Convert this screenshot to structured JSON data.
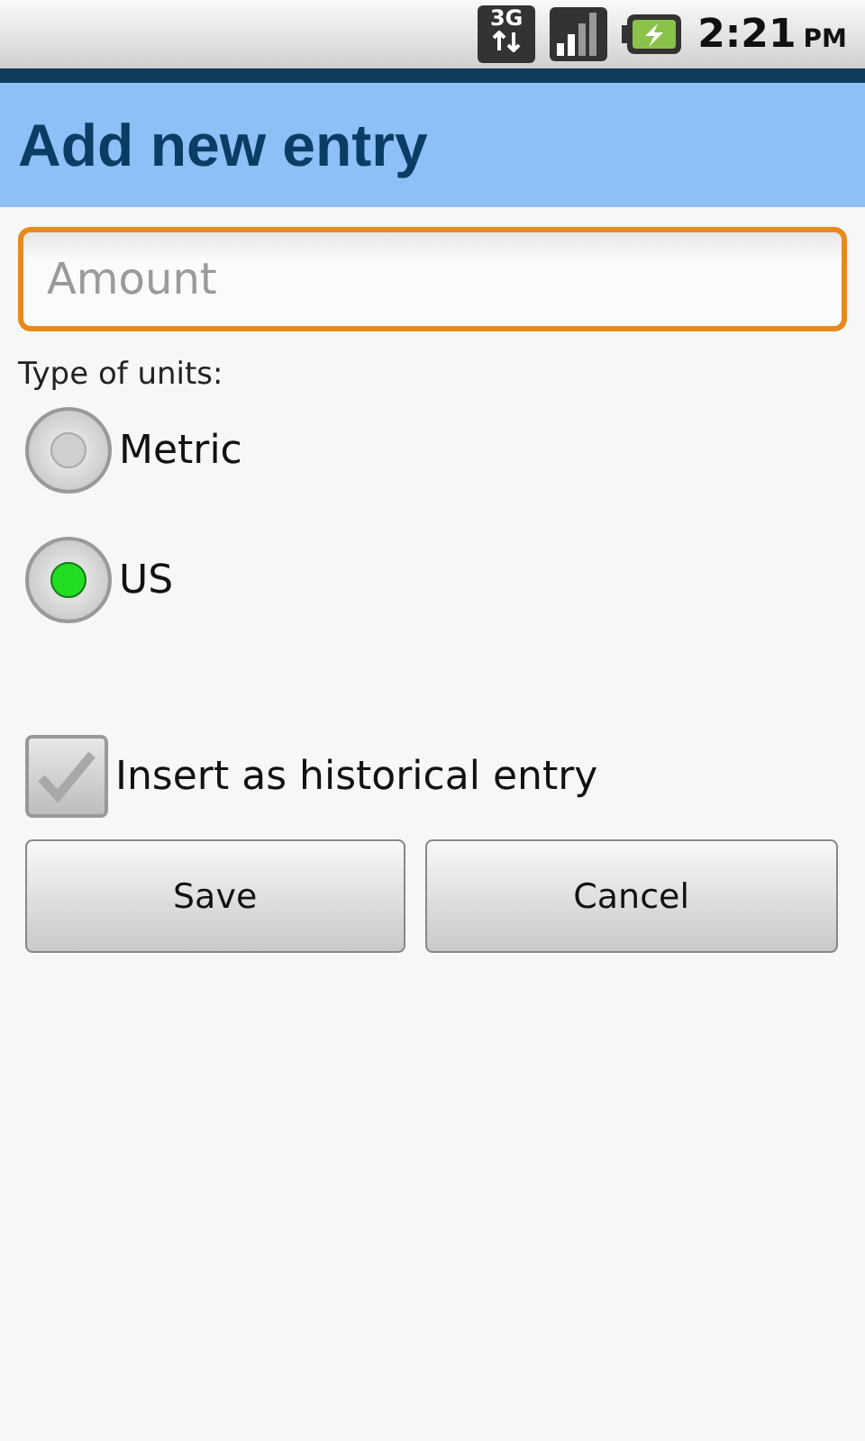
{
  "status_bar": {
    "network": "3G",
    "time": "2:21",
    "period": "PM"
  },
  "title": "Add new entry",
  "amount": {
    "placeholder": "Amount",
    "focused": true
  },
  "units": {
    "label": "Type of units:",
    "options": [
      {
        "label": "Metric",
        "selected": false
      },
      {
        "label": "US",
        "selected": true
      }
    ]
  },
  "historical": {
    "label": "Insert as historical entry",
    "checked": false
  },
  "buttons": [
    "Save",
    "Cancel"
  ]
}
